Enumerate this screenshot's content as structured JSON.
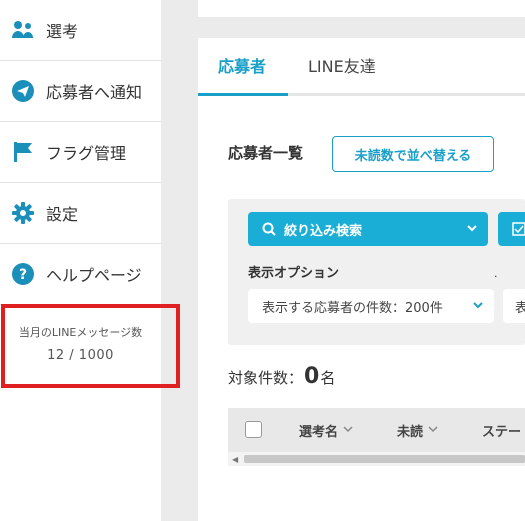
{
  "sidebar": {
    "items": [
      {
        "icon": "people-icon",
        "label": "選考"
      },
      {
        "icon": "paper-plane-icon",
        "label": "応募者へ通知"
      },
      {
        "icon": "flag-icon",
        "label": "フラグ管理"
      },
      {
        "icon": "gear-icon",
        "label": "設定"
      },
      {
        "icon": "help-icon",
        "label": "ヘルプページ"
      }
    ],
    "quota": {
      "title": "当月のLINEメッセージ数",
      "value": "12 / 1000"
    }
  },
  "tabs": [
    {
      "label": "応募者",
      "active": true
    },
    {
      "label": "LINE友達",
      "active": false
    }
  ],
  "main": {
    "title": "応募者一覧",
    "sort_button": "未読数で並べ替える",
    "filter_button": "絞り込み検索",
    "option_label": "表示オプション",
    "dot": ".",
    "select_value": "表示する応募者の件数：200件",
    "select2_partial": "表",
    "count_prefix": "対象件数：",
    "count_value": "0",
    "count_suffix": "名",
    "columns": [
      "選考名",
      "未読",
      "ステー"
    ]
  },
  "colors": {
    "accent": "#1a9fc9",
    "button": "#1aaed6",
    "highlight": "#e02020"
  }
}
